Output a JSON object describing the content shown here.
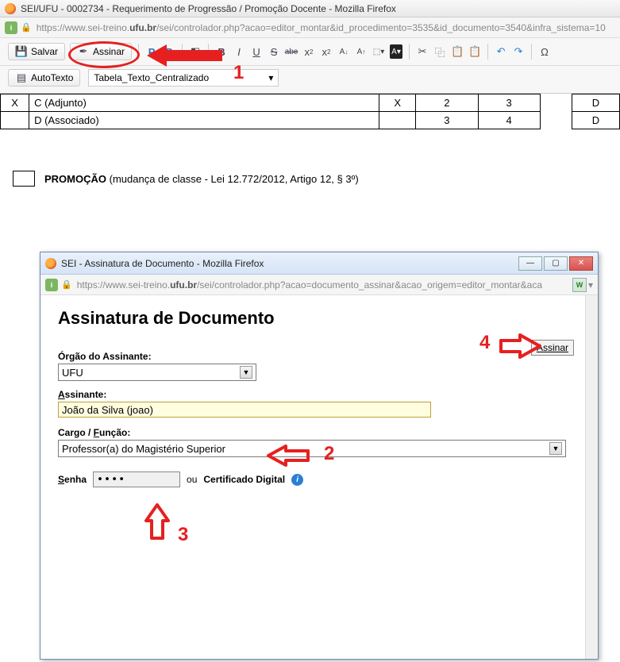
{
  "colors": {
    "annotation_red": "#e62020"
  },
  "main_window": {
    "title": "SEI/UFU - 0002734 - Requerimento de Progressão / Promoção Docente - Mozilla Firefox",
    "url_prefix": "https://www.sei-treino.",
    "url_bold": "ufu.br",
    "url_suffix": "/sei/controlador.php?acao=editor_montar&id_procedimento=3535&id_documento=3540&infra_sistema=10"
  },
  "toolbar": {
    "salvar_label": "Salvar",
    "assinar_label": "Assinar",
    "autotexto_label": "AutoTexto",
    "style_value": "Tabela_Texto_Centralizado"
  },
  "doc": {
    "rows": [
      {
        "mark": "X",
        "label": "C (Adjunto)",
        "c1": "X",
        "c2": "2",
        "c3": "3",
        "c4": "D"
      },
      {
        "mark": "",
        "label": "D (Associado)",
        "c1": "",
        "c2": "3",
        "c3": "4",
        "c4": "D"
      }
    ],
    "promocao_strong": "PROMOÇÃO",
    "promocao_rest": " (mudança de classe - Lei 12.772/2012, Artigo 12, § 3º)"
  },
  "dialog": {
    "title": "SEI - Assinatura de Documento - Mozilla Firefox",
    "url_prefix": "https://www.sei-treino.",
    "url_bold": "ufu.br",
    "url_suffix": "/sei/controlador.php?acao=documento_assinar&acao_origem=editor_montar&aca",
    "heading": "Assinatura de Documento",
    "assinar_btn": "Assinar",
    "orgao_label": "Órgão do Assinante:",
    "orgao_value": "UFU",
    "assinante_label": "Assinante:",
    "assinante_value": "João da Silva (joao)",
    "cargo_label": "Cargo / Função:",
    "cargo_value": "Professor(a) do Magistério Superior",
    "senha_label": "Senha",
    "senha_value": "••••",
    "ou_label": "ou",
    "cert_label": "Certificado Digital"
  },
  "annotations": {
    "n1": "1",
    "n2": "2",
    "n3": "3",
    "n4": "4"
  }
}
